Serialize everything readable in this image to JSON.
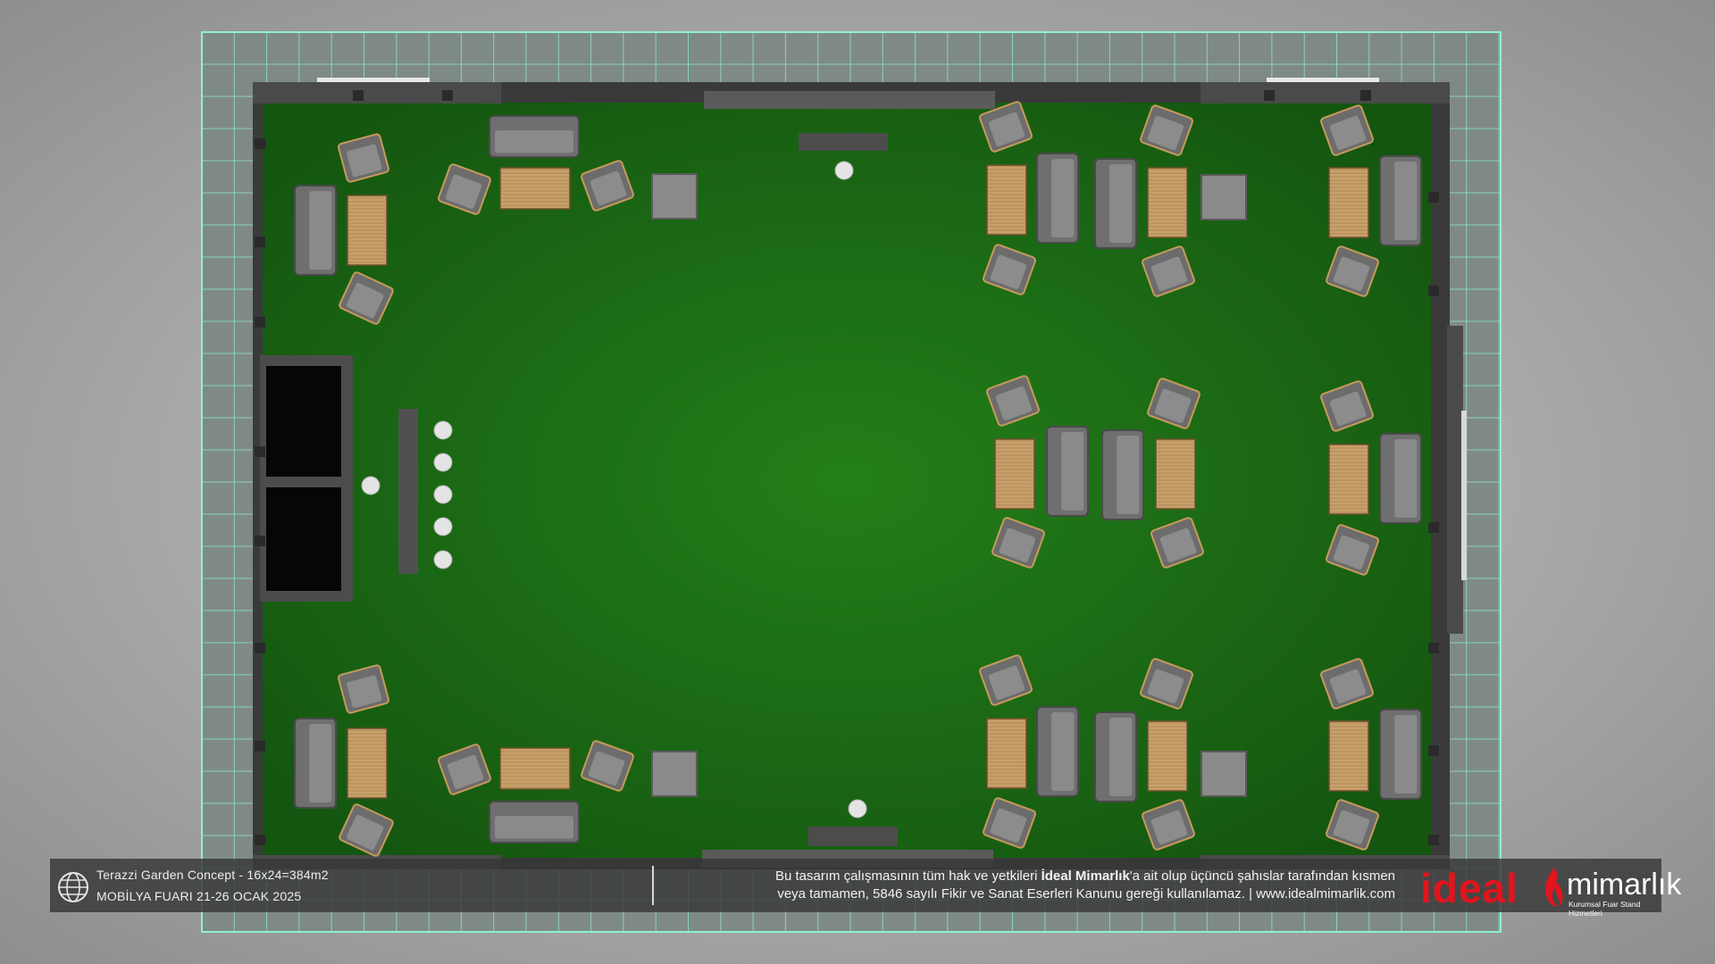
{
  "project": {
    "title": "Terazzi Garden Concept - 16x24=384m2",
    "event": "MOBİLYA FUARI 21-26 OCAK 2025"
  },
  "legal": {
    "line1_prefix": "Bu tasarım çalışmasının tüm hak ve yetkileri ",
    "line1_brand": "İdeal Mimarlık",
    "line1_suffix": "'a ait olup üçüncü şahıslar tarafından kısmen",
    "line2": "veya tamamen, 5846 sayılı Fikir ve Sanat Eserleri Kanunu gereği kullanılamaz. | www.idealmimarlik.com"
  },
  "brand": {
    "name_main": "ideal",
    "name_secondary": "mimarlık",
    "tagline": "Kurumsal Fuar Stand Hizmetleri"
  },
  "icons": [
    "globe-icon",
    "flame-icon"
  ],
  "colors": {
    "floor": "#1e7a14",
    "grid_line": "#7fe6c6",
    "table_wood": "#c9a06a",
    "furniture_gray": "#777777",
    "brand_red": "#e3141c"
  }
}
